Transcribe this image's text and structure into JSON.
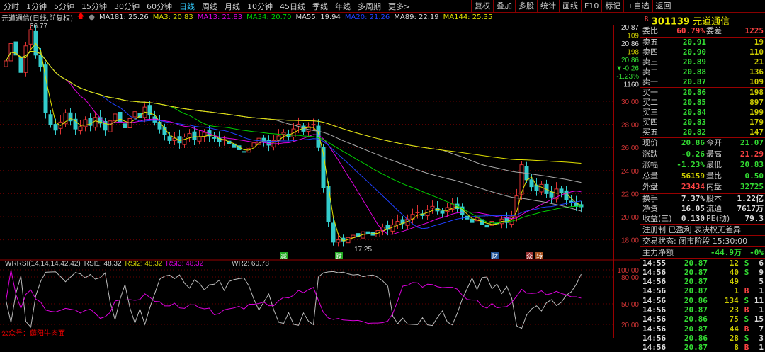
{
  "periods": [
    "分时",
    "1分钟",
    "5分钟",
    "15分钟",
    "30分钟",
    "60分钟",
    "日线",
    "周线",
    "月线",
    "10分钟",
    "45日线",
    "季线",
    "年线",
    "多周期",
    "更多>"
  ],
  "active_period": "日线",
  "tools": [
    "复权",
    "叠加",
    "多股",
    "统计",
    "画线",
    "F10",
    "标记",
    "+自选",
    "返回"
  ],
  "stock": {
    "badge": "R",
    "code": "301139",
    "name": "元道通信"
  },
  "chart_header": {
    "title": "元道通信(日线,前复权)",
    "ma": [
      {
        "label": "MA181: 25.26",
        "color": "#dddddd"
      },
      {
        "label": "MA3: 20.83",
        "color": "#e0e000"
      },
      {
        "label": "MA13: 21.83",
        "color": "#e000e0"
      },
      {
        "label": "MA34: 20.70",
        "color": "#00d000"
      },
      {
        "label": "MA55: 19.94",
        "color": "#dddddd"
      },
      {
        "label": "MA20: 21.26",
        "color": "#2040ff"
      },
      {
        "label": "MA89: 22.19",
        "color": "#dddddd"
      },
      {
        "label": "MA144: 25.35",
        "color": "#e0e000"
      }
    ]
  },
  "price_axis": [
    "30.00",
    "28.00",
    "26.00",
    "24.00",
    "22.00",
    "20.00",
    "18.00"
  ],
  "rsi_axis": [
    "100.00",
    "80.00",
    "50.00",
    "20.00"
  ],
  "mini_quote": [
    "20.87",
    "109",
    "20.86",
    "198",
    "20.86",
    "▼-0.26",
    "-1.23%",
    "1160"
  ],
  "annotations": {
    "high": "36.77",
    "low": "17.25",
    "tags": [
      "减",
      "跌",
      "财",
      "众",
      "转"
    ]
  },
  "rsi_header": {
    "name": "WRRSI(14,14,14,42,42)",
    "rsi1": "RSI1: 48.32",
    "rsi2": "RSI2: 48.32",
    "rsi3": "RSI3: 48.32",
    "wr2": "WR2: 60.78"
  },
  "watermark": "公众号：薅阳牛肉面",
  "order_book": {
    "wb_label": "委比",
    "wb": "60.79%",
    "wc_label": "委差",
    "wc": "1225",
    "asks": [
      {
        "l": "卖五",
        "p": "20.91",
        "v": "19"
      },
      {
        "l": "卖四",
        "p": "20.90",
        "v": "110"
      },
      {
        "l": "卖三",
        "p": "20.89",
        "v": "21"
      },
      {
        "l": "卖二",
        "p": "20.88",
        "v": "136"
      },
      {
        "l": "卖一",
        "p": "20.87",
        "v": "109"
      }
    ],
    "bids": [
      {
        "l": "买一",
        "p": "20.86",
        "v": "198"
      },
      {
        "l": "买二",
        "p": "20.85",
        "v": "897"
      },
      {
        "l": "买三",
        "p": "20.84",
        "v": "199"
      },
      {
        "l": "买四",
        "p": "20.83",
        "v": "179"
      },
      {
        "l": "买五",
        "p": "20.82",
        "v": "147"
      }
    ]
  },
  "quote": [
    {
      "l1": "现价",
      "v1": "20.86",
      "c1": "g",
      "l2": "今开",
      "v2": "21.07",
      "c2": "g"
    },
    {
      "l1": "涨跌",
      "v1": "-0.26",
      "c1": "g",
      "l2": "最高",
      "v2": "21.29",
      "c2": "r"
    },
    {
      "l1": "涨幅",
      "v1": "-1.23%",
      "c1": "g",
      "l2": "最低",
      "v2": "20.83",
      "c2": "g"
    },
    {
      "l1": "总量",
      "v1": "56159",
      "c1": "y",
      "l2": "量比",
      "v2": "0.50",
      "c2": "g"
    },
    {
      "l1": "外盘",
      "v1": "23434",
      "c1": "r",
      "l2": "内盘",
      "v2": "32725",
      "c2": "g"
    }
  ],
  "fundamentals": [
    {
      "l1": "换手",
      "v1": "7.37%",
      "l2": "股本",
      "v2": "1.22亿"
    },
    {
      "l1": "净资",
      "v1": "16.05",
      "l2": "流通",
      "v2": "7617万"
    },
    {
      "l1": "收益(三)",
      "v1": "0.130",
      "l2": "PE(动)",
      "v2": "79.3"
    }
  ],
  "reg_note": "注册制 已盈利 表决权无差异",
  "trade_status": "交易状态: 闭市阶段 15:30:00",
  "main_flow": {
    "label": "主力净额",
    "value": "-44.9万",
    "pct": "-0%"
  },
  "ticks": [
    {
      "t": "14:55",
      "p": "20.87",
      "v": "12",
      "s": "S",
      "n": "6"
    },
    {
      "t": "14:56",
      "p": "20.87",
      "v": "40",
      "s": "S",
      "n": "9"
    },
    {
      "t": "14:56",
      "p": "20.87",
      "v": "49",
      "s": "",
      "n": "5"
    },
    {
      "t": "14:56",
      "p": "20.87",
      "v": "1",
      "s": "B",
      "n": "1"
    },
    {
      "t": "14:56",
      "p": "20.86",
      "v": "134",
      "s": "S",
      "n": "11"
    },
    {
      "t": "14:56",
      "p": "20.87",
      "v": "23",
      "s": "B",
      "n": "1"
    },
    {
      "t": "14:56",
      "p": "20.86",
      "v": "75",
      "s": "S",
      "n": "15"
    },
    {
      "t": "14:56",
      "p": "20.87",
      "v": "44",
      "s": "B",
      "n": "7"
    },
    {
      "t": "14:56",
      "p": "20.86",
      "v": "28",
      "s": "S",
      "n": "3"
    },
    {
      "t": "14:56",
      "p": "20.87",
      "v": "8",
      "s": "B",
      "n": "1"
    }
  ],
  "closes": [
    33.5,
    35,
    34,
    32.5,
    34.8,
    36.2,
    34,
    33,
    29,
    28,
    27.5,
    28.2,
    29,
    28.3,
    27.6,
    27.8,
    28.4,
    27.9,
    28.6,
    28.1,
    27.5,
    28.3,
    28.9,
    28.2,
    27.7,
    28.5,
    29.1,
    28.6,
    29.5,
    28.8,
    28.2,
    27.6,
    27.1,
    26.6,
    26.8,
    26.4,
    26.9,
    27.2,
    26.7,
    26.9,
    27.3,
    27.0,
    26.8,
    26.5,
    26.7,
    26.3,
    26.0,
    25.8,
    25.6,
    25.9,
    26.4,
    26.8,
    26.5,
    26.2,
    26.6,
    27.0,
    27.3,
    26.9,
    27.6,
    28.0,
    27.4,
    27.8,
    28.0,
    26.0,
    22.5,
    19.6,
    17.8,
    18.0,
    17.9,
    18.2,
    18.4,
    18.3,
    18.7,
    18.5,
    18.4,
    18.8,
    19.1,
    18.9,
    19.3,
    19.6,
    19.4,
    19.8,
    20.2,
    20.4,
    20.1,
    20.6,
    20.9,
    20.5,
    20.3,
    20.8,
    21.1,
    20.7,
    20.2,
    19.8,
    19.5,
    19.9,
    19.3,
    19.1,
    19.6,
    19.4,
    19.8,
    19.5,
    20.0,
    21.8,
    24.5,
    23.2,
    22.6,
    22.3,
    22.8,
    22.0,
    21.7,
    22.4,
    22.1,
    21.5,
    21.2,
    20.9,
    20.86
  ]
}
